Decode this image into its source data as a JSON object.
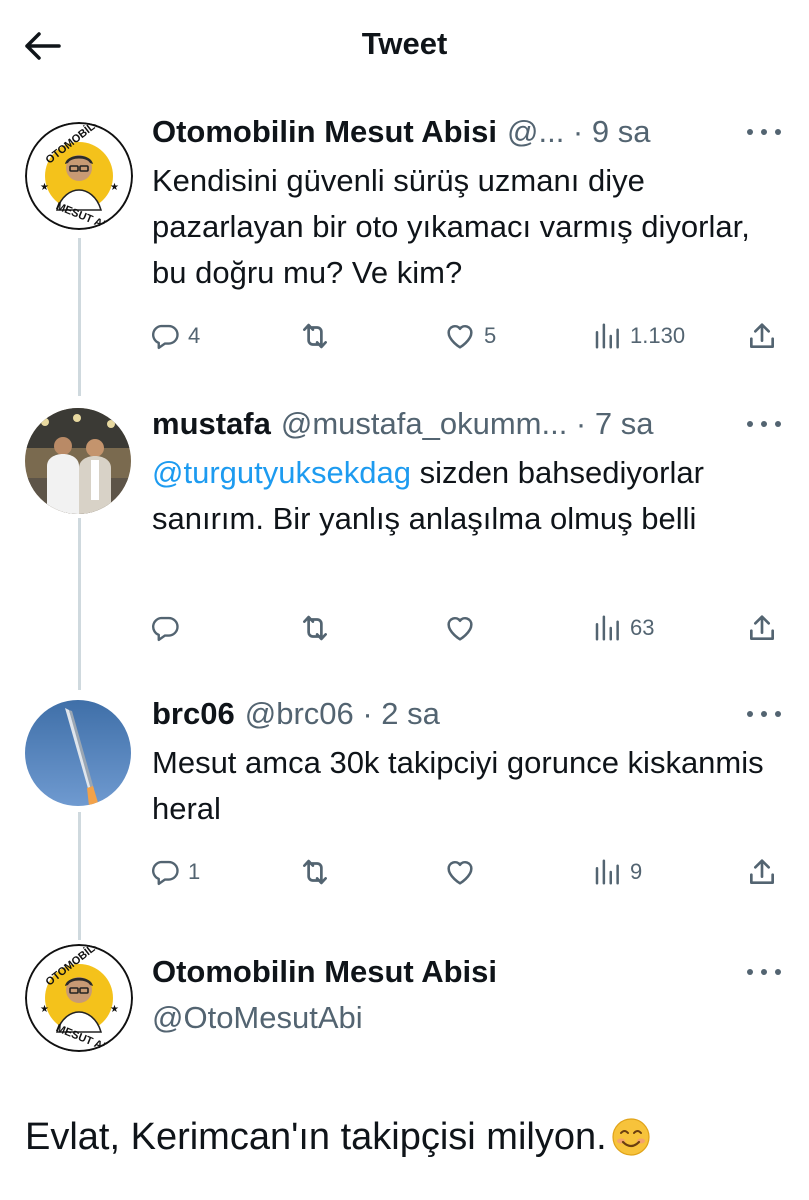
{
  "header": {
    "title": "Tweet"
  },
  "tweets": [
    {
      "name": "Otomobilin Mesut Abisi",
      "meta": "@... · 9 sa",
      "text": "Kendisini güvenli sürüş uzmanı diye pazarlayan bir oto yıkamacı varmış diyorlar, bu doğru mu? Ve kim?",
      "replies": "4",
      "retweets": "",
      "likes": "5",
      "views": "1.130",
      "avatar_text_top": "OTOMOBİLİN",
      "avatar_text_bottom": "MESUT ABİSİ"
    },
    {
      "name": "mustafa",
      "meta": "@mustafa_okumm... · 7 sa",
      "mention": "@turgutyuksekdag",
      "text": " sizden bahsediyorlar sanırım. Bir yanlış anlaşılma olmuş belli",
      "replies": "",
      "retweets": "",
      "likes": "",
      "views": "63"
    },
    {
      "name": "brc06",
      "meta": "@brc06 · 2 sa",
      "text": "Mesut amca 30k takipciyi gorunce kiskanmis heral",
      "replies": "1",
      "retweets": "",
      "likes": "",
      "views": "9"
    }
  ],
  "main_tweet": {
    "name": "Otomobilin Mesut Abisi",
    "handle": "@OtoMesutAbi",
    "text": "Evlat, Kerimcan'ın takipçisi milyon.",
    "emoji": "smiling-face"
  },
  "colors": {
    "link": "#1d9bf0",
    "muted": "#536471",
    "thread_line": "#cfd9de"
  }
}
